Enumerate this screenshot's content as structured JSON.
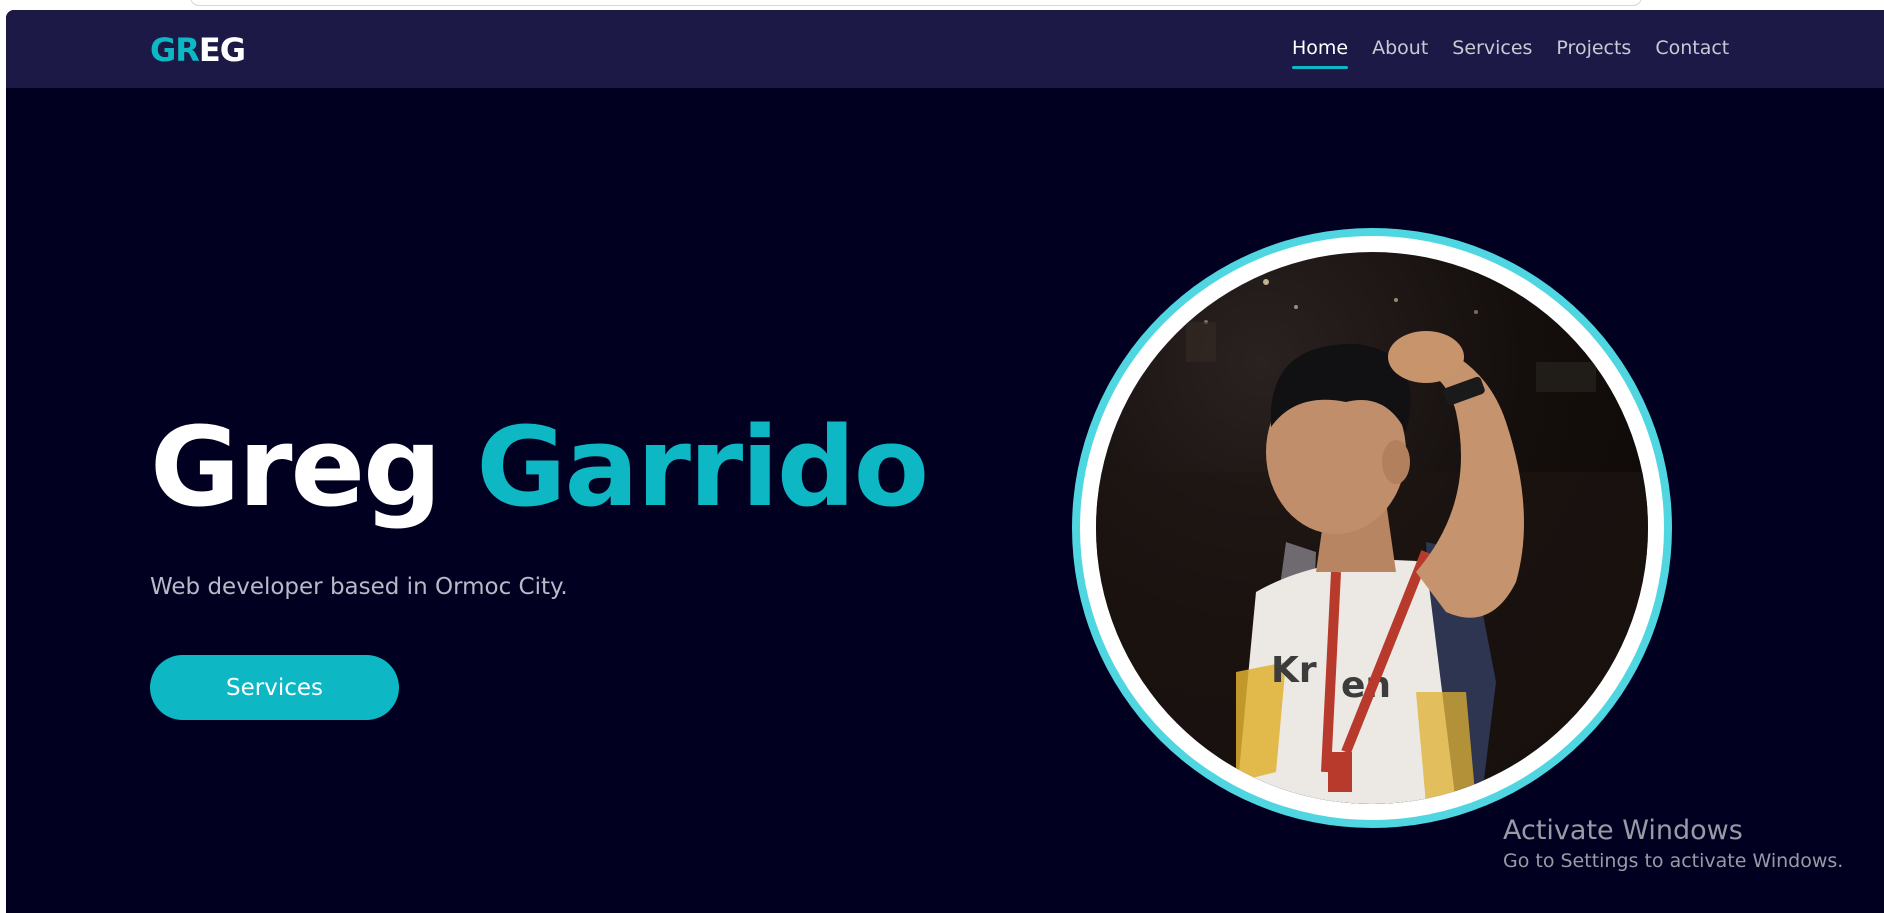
{
  "navbar": {
    "logo_accent": "GR",
    "logo_rest": "EG",
    "links": [
      {
        "label": "Home",
        "active": true
      },
      {
        "label": "About",
        "active": false
      },
      {
        "label": "Services",
        "active": false
      },
      {
        "label": "Projects",
        "active": false
      },
      {
        "label": "Contact",
        "active": false
      }
    ]
  },
  "hero": {
    "first_name": "Greg",
    "last_name": "Garrido",
    "tagline": "Web developer based in Ormoc City.",
    "button_label": "Services"
  },
  "portrait": {
    "subject": "person-photo"
  },
  "watermark": {
    "title": "Activate Windows",
    "subtitle": "Go to Settings to activate Windows."
  },
  "colors": {
    "accent": "#0db7c4",
    "background": "#020021",
    "navbar": "#1c1946",
    "ring": "#4fd6e0"
  }
}
